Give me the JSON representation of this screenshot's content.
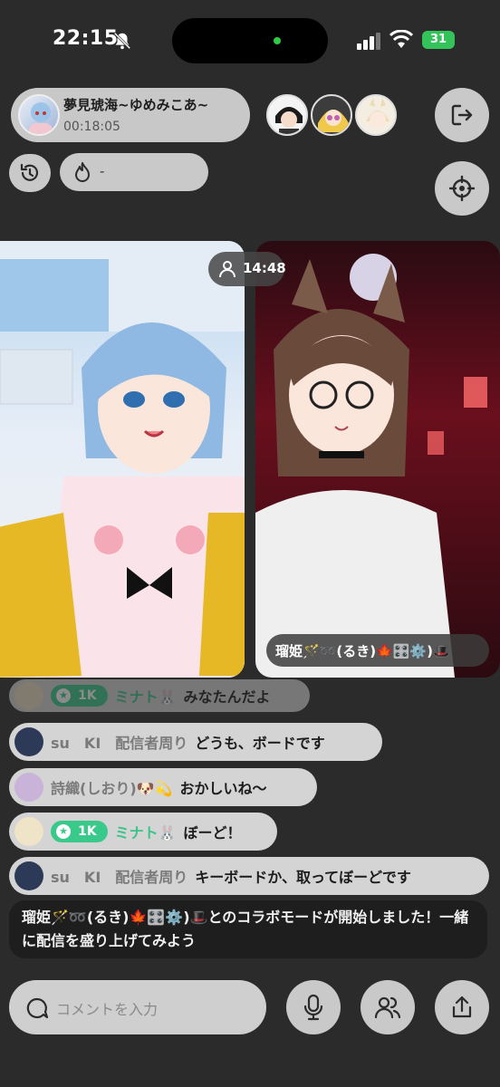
{
  "status_bar": {
    "time": "22:15",
    "battery": "31"
  },
  "host": {
    "name": "夢見琥海~ゆめみこあ~",
    "duration": "00:18:05"
  },
  "heat": {
    "value": "-"
  },
  "collab": {
    "timer": "14:48",
    "partner_name": "瑠姫🪄➿(るき)🍁🎛️⚙️)🎩"
  },
  "chat": [
    {
      "user": "ミナト🐰",
      "badge": "1K",
      "message": "みなたんだよ",
      "faded": true
    },
    {
      "user": "su　KI　配信者周り",
      "badge": "",
      "message": "どうも、ボードです"
    },
    {
      "user": "詩織(しおり)🐶💫",
      "badge": "",
      "message": "おかしいね〜"
    },
    {
      "user": "ミナト🐰",
      "badge": "1K",
      "message": "ぼーど！"
    },
    {
      "user": "su　KI　配信者周り",
      "badge": "",
      "message": "キーボードか、取ってぼーどです"
    }
  ],
  "system_message": "瑠姫🪄➿(るき)🍁🎛️⚙️)🎩とのコラボモードが開始しました！一緒に配信を盛り上げてみよう",
  "comment_input": {
    "placeholder": "コメントを入力"
  },
  "colors": {
    "background": "#2b2b2b",
    "pill": "#c9c9c9",
    "badge_green": "#39c98a"
  },
  "icons": [
    "bell-slash-icon",
    "signal-icon",
    "wifi-icon",
    "exit-icon",
    "history-icon",
    "flame-icon",
    "crosshair-icon",
    "viewer-icon",
    "comment-icon",
    "mic-icon",
    "guests-icon",
    "share-icon"
  ]
}
